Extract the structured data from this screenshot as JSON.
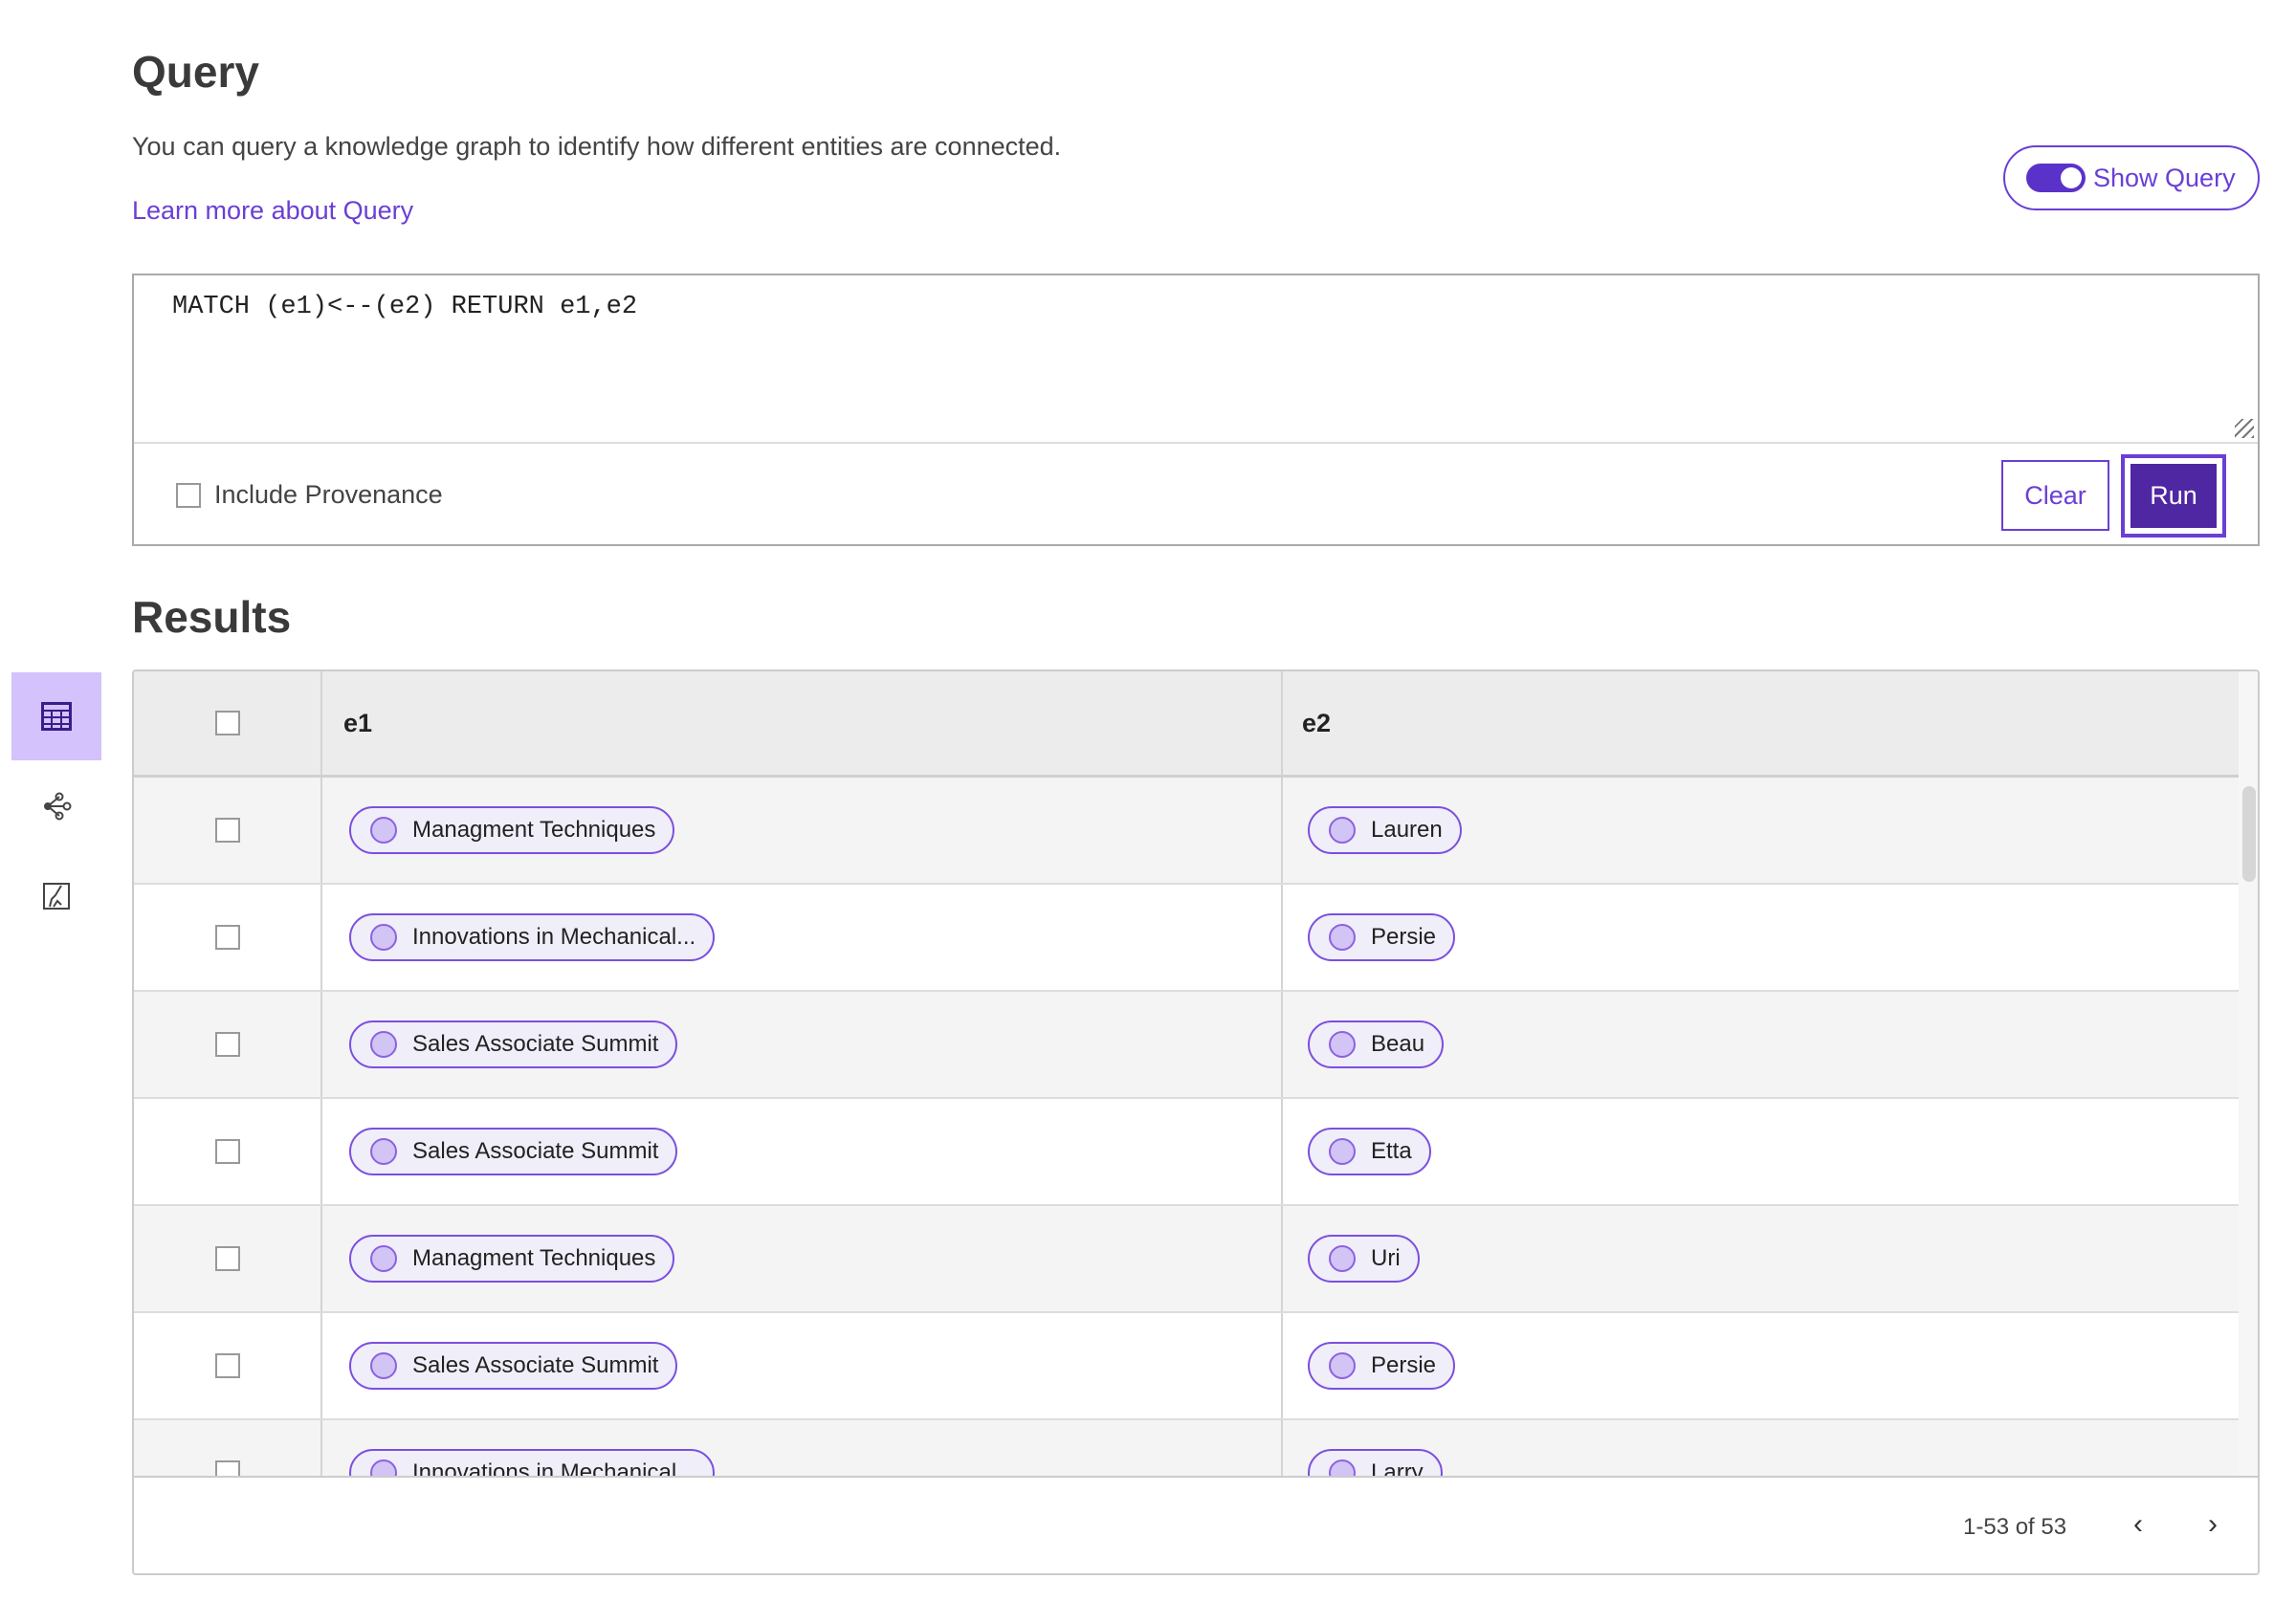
{
  "header": {
    "title": "Query",
    "description": "You can query a knowledge graph to identify how different entities are connected.",
    "learn_more": "Learn more about Query",
    "show_query_label": "Show Query",
    "show_query_on": true
  },
  "query": {
    "text": "MATCH (e1)<--(e2) RETURN e1,e2",
    "include_provenance_label": "Include Provenance",
    "clear_label": "Clear",
    "run_label": "Run"
  },
  "results": {
    "title": "Results",
    "columns": [
      "e1",
      "e2"
    ],
    "rows": [
      {
        "e1": "Managment Techniques",
        "e2": "Lauren"
      },
      {
        "e1": "Innovations in Mechanical...",
        "e2": "Persie"
      },
      {
        "e1": "Sales Associate Summit",
        "e2": "Beau"
      },
      {
        "e1": "Sales Associate Summit",
        "e2": "Etta"
      },
      {
        "e1": "Managment Techniques",
        "e2": "Uri"
      },
      {
        "e1": "Sales Associate Summit",
        "e2": "Persie"
      },
      {
        "e1": "Innovations in Mechanical...",
        "e2": "Larry"
      }
    ],
    "pagination": "1-53 of 53"
  },
  "sidebar": {
    "items": [
      {
        "icon": "table-icon",
        "active": true
      },
      {
        "icon": "graph-icon",
        "active": false
      },
      {
        "icon": "chart-icon",
        "active": false
      }
    ]
  },
  "colors": {
    "accent": "#6a3fd4",
    "run_bg": "#4f27a3",
    "active_side": "#d3c2fc"
  }
}
